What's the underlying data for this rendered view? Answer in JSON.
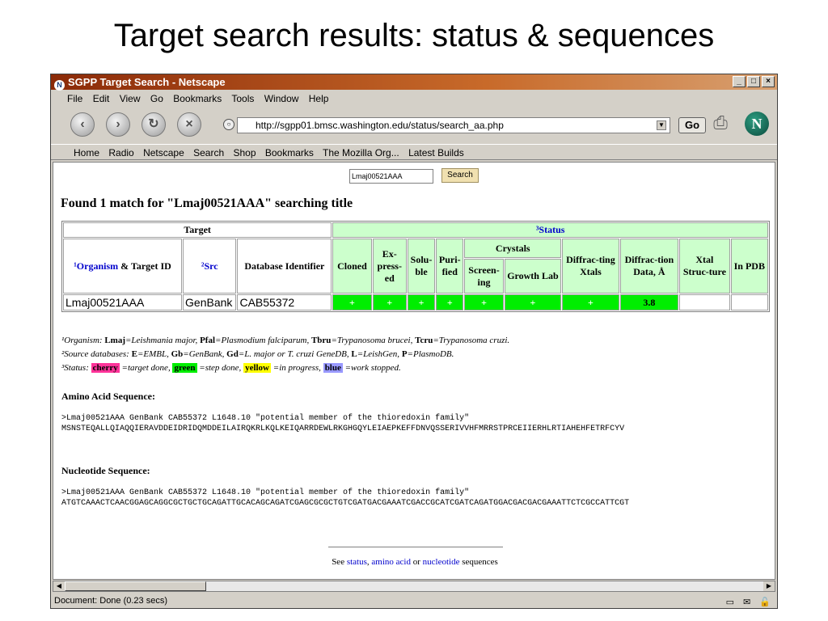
{
  "slide": {
    "title": "Target search results: status & sequences"
  },
  "window": {
    "title": "SGPP Target Search - Netscape",
    "controls": [
      "_",
      "□",
      "×"
    ]
  },
  "menu": [
    "File",
    "Edit",
    "View",
    "Go",
    "Bookmarks",
    "Tools",
    "Window",
    "Help"
  ],
  "nav": {
    "url": "http://sgpp01.bmsc.washington.edu/status/search_aa.php",
    "go_label": "Go",
    "logo_letter": "N"
  },
  "bookmarks": [
    "Home",
    "Radio",
    "Netscape",
    "Search",
    "Shop",
    "Bookmarks",
    "The Mozilla Org...",
    "Latest Builds"
  ],
  "search": {
    "value": "Lmaj00521AAA",
    "button": "Search"
  },
  "found_text": "Found 1 match for \"Lmaj00521AAA\" searching title",
  "table": {
    "group_target": "Target",
    "group_status": "³Status",
    "organism_sup": "¹",
    "organism_link": "Organism",
    "organism_rest": " & Target ID",
    "src": "²Src",
    "db_id": "Database Identifier",
    "cloned": "Cloned",
    "expressed": "Ex-press-ed",
    "soluble": "Solu-ble",
    "purified": "Puri-fied",
    "crystals": "Crystals",
    "screening": "Screen-ing",
    "growth_lab": "Growth Lab",
    "diffracting": "Diffrac-ting Xtals",
    "diffraction_data": "Diffrac-tion Data, Å",
    "xtal_structure": "Xtal Struc-ture",
    "in_pdb": "In PDB",
    "row": {
      "target_id": "Lmaj00521AAA",
      "src": "GenBank",
      "db_id": "CAB55372",
      "cloned": "+",
      "expressed": "+",
      "soluble": "+",
      "purified": "+",
      "screening": "+",
      "growth_lab": "+",
      "diffracting": "+",
      "diffraction_data": "3.8",
      "xtal_structure": "",
      "in_pdb": ""
    }
  },
  "notes": {
    "organism": "¹Organism: ",
    "lmaj_k": "Lmaj",
    "lmaj_v": "=Leishmania major, ",
    "pfal_k": "Pfal",
    "pfal_v": "=Plasmodium falciparum, ",
    "tbru_k": "Tbru",
    "tbru_v": "=Trypanosoma brucei, ",
    "tcru_k": "Tcru",
    "tcru_v": "=Trypanosoma cruzi.",
    "source": "²Source databases: ",
    "e_k": "E",
    "e_v": "=EMBL, ",
    "gb_k": "Gb",
    "gb_v": "=GenBank, ",
    "gd_k": "Gd",
    "gd_v": "=L. major or T. cruzi GeneDB, ",
    "l_k": "L",
    "l_v": "=LeishGen, ",
    "p_k": "P",
    "p_v": "=PlasmoDB.",
    "status": "³Status: ",
    "cherry": "cherry",
    "cherry_v": " =target done, ",
    "green": "green",
    "green_v": " =step done, ",
    "yellow": "yellow",
    "yellow_v": " =in progress, ",
    "blue": "blue",
    "blue_v": " =work stopped."
  },
  "colors": {
    "cherry": "#ff3399",
    "green": "#00ee00",
    "yellow": "#ffff00",
    "blue": "#9999ff"
  },
  "amino": {
    "title": "Amino Acid Sequence:",
    "header": ">Lmaj00521AAA GenBank CAB55372 L1648.10 \"potential member of the thioredoxin family\"",
    "seq": "MSNSTEQALLQIAQQIERAVDDEIDRIDQMDDEILAIRQKRLKQLKEIQARRDEWLRKGHGQYLEIAEPKEFFDNVQSSERIVVHFMRRSTPRCEIIERHLRTIAHEHFETRFCYV"
  },
  "nucleotide": {
    "title": "Nucleotide Sequence:",
    "header": ">Lmaj00521AAA GenBank CAB55372 L1648.10 \"potential member of the thioredoxin family\"",
    "seq": "ATGTCAAACTCAACGGAGCAGGCGCTGCTGCAGATTGCACAGCAGATCGAGCGCGCTGTCGATGACGAAATCGACCGCATCGATCAGATGGACGACGACGAAATTCTCGCCATTCGT"
  },
  "footer": {
    "see": "See ",
    "status": "status",
    "comma": ", ",
    "amino": "amino acid",
    "or": " or ",
    "nucleotide": "nucleotide",
    "tail": " sequences"
  },
  "statusbar": {
    "text": "Document: Done (0.23 secs)"
  }
}
